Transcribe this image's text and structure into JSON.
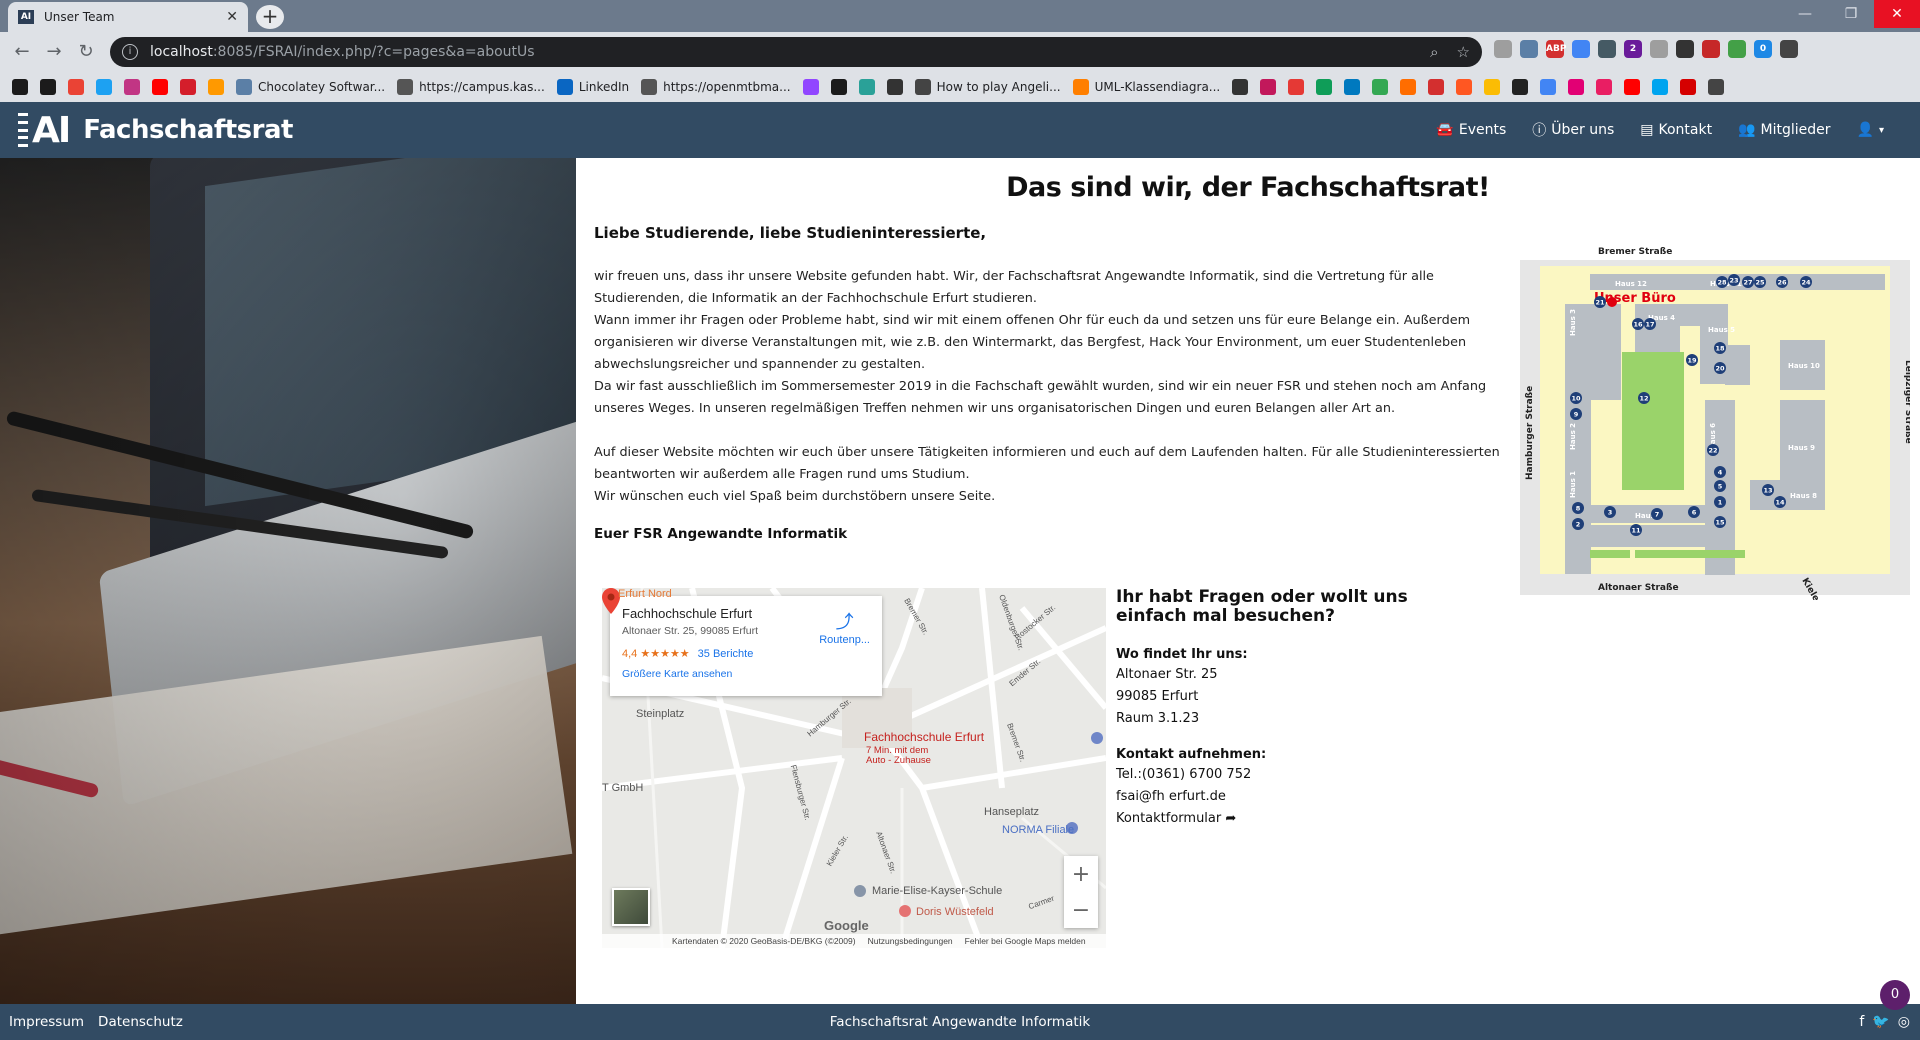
{
  "browser": {
    "tab_title": "Unser Team",
    "favicon_text": "AI",
    "url_host": "localhost",
    "url_path": ":8085/FSRAI/index.php/?c=pages&a=aboutUs",
    "bookmarks": [
      {
        "label": "",
        "color": "#1b1b1b"
      },
      {
        "label": "",
        "color": "#1b1b1b"
      },
      {
        "label": "",
        "color": "#ea4335"
      },
      {
        "label": "",
        "color": "#1da1f2"
      },
      {
        "label": "",
        "color": "#c13584"
      },
      {
        "label": "",
        "color": "#ff0000"
      },
      {
        "label": "",
        "color": "#d41e2b"
      },
      {
        "label": "",
        "color": "#ff9900"
      },
      {
        "label": "Chocolatey Softwar...",
        "color": "#5b7fa6"
      },
      {
        "label": "https://campus.kas...",
        "color": "#555555"
      },
      {
        "label": "LinkedIn",
        "color": "#0a66c2"
      },
      {
        "label": "https://openmtbma...",
        "color": "#555555"
      },
      {
        "label": "",
        "color": "#9146ff"
      },
      {
        "label": "",
        "color": "#1b1b1b"
      },
      {
        "label": "",
        "color": "#2aa198"
      },
      {
        "label": "",
        "color": "#333333"
      },
      {
        "label": "How to play Angeli...",
        "color": "#444444"
      },
      {
        "label": "UML-Klassendiagra...",
        "color": "#ff7f00"
      },
      {
        "label": "",
        "color": "#333333"
      },
      {
        "label": "",
        "color": "#c2185b"
      },
      {
        "label": "",
        "color": "#e53935"
      },
      {
        "label": "",
        "color": "#0f9d58"
      },
      {
        "label": "",
        "color": "#0079bf"
      },
      {
        "label": "",
        "color": "#34a853"
      },
      {
        "label": "",
        "color": "#ff6d00"
      },
      {
        "label": "",
        "color": "#d32f2f"
      },
      {
        "label": "",
        "color": "#ff5722"
      },
      {
        "label": "",
        "color": "#fbbc04"
      },
      {
        "label": "",
        "color": "#222222"
      },
      {
        "label": "",
        "color": "#4285f4"
      },
      {
        "label": "",
        "color": "#e20074"
      },
      {
        "label": "",
        "color": "#e91e63"
      },
      {
        "label": "",
        "color": "#ff0000"
      },
      {
        "label": "",
        "color": "#00a4ef"
      },
      {
        "label": "",
        "color": "#d50000"
      },
      {
        "label": "",
        "color": "#444444"
      }
    ],
    "extensions": [
      {
        "label": "",
        "color": "#9e9e9e"
      },
      {
        "label": "",
        "color": "#5b7fa6"
      },
      {
        "label": "ABP",
        "color": "#d32f2f"
      },
      {
        "label": "",
        "color": "#4285f4"
      },
      {
        "label": "",
        "color": "#455a64"
      },
      {
        "label": "2",
        "color": "#6a1b9a"
      },
      {
        "label": "",
        "color": "#9e9e9e"
      },
      {
        "label": "",
        "color": "#333333"
      },
      {
        "label": "",
        "color": "#c62828"
      },
      {
        "label": "",
        "color": "#43a047"
      },
      {
        "label": "0",
        "color": "#1e88e5"
      },
      {
        "label": "",
        "color": "#444444"
      }
    ]
  },
  "nav": {
    "brand": "Fachschaftsrat",
    "logo": "AI",
    "links": [
      {
        "label": "Events",
        "icon": "car-icon"
      },
      {
        "label": "Über uns",
        "icon": "info-icon"
      },
      {
        "label": "Kontakt",
        "icon": "address-card-icon"
      },
      {
        "label": "Mitglieder",
        "icon": "users-icon"
      }
    ],
    "user_icon": "user-icon"
  },
  "main": {
    "title": "Das sind wir, der Fachschaftsrat!",
    "greeting": "Liebe Studierende, liebe Studieninteressierte,",
    "paragraphs": [
      "wir freuen uns, dass ihr unsere Website gefunden habt. Wir, der Fachschaftsrat Angewandte Informatik, sind die Vertretung für alle Studierenden, die Informatik an der Fachhochschule Erfurt studieren.",
      "Wann immer ihr Fragen oder Probleme habt, sind wir mit einem offenen Ohr für euch da und setzen uns für eure Belange ein. Außerdem organisieren wir diverse Veranstaltungen mit, wie z.B. den Wintermarkt, das Bergfest, Hack Your Environment, um euer Studentenleben abwechslungsreicher und spannender zu gestalten.",
      "Da wir fast ausschließlich im Sommersemester 2019 in die Fachschaft gewählt wurden, sind wir ein neuer FSR und stehen noch am Anfang unseres Weges. In unseren regelmäßigen Treffen nehmen wir uns organisatorischen Dingen und euren Belangen aller Art an.",
      "Auf dieser Website möchten wir euch über unsere Tätigkeiten informieren und euch auf dem Laufenden halten. Für alle Studieninteressierten beantworten wir außerdem alle Fragen rund ums Studium.",
      "Wir wünschen euch viel Spaß beim durchstöbern unsere Seite."
    ],
    "signature": "Euer FSR Angewandte Informatik"
  },
  "campus_map": {
    "street_top": "Bremer Straße",
    "street_bottom": "Altonaer Straße",
    "street_left": "Hamburger Straße",
    "street_right": "Leipziger Straße",
    "street_corner": "Kieler",
    "office_label": "Unser Büro",
    "buildings": [
      "Haus 12",
      "Haus 11",
      "Haus 4",
      "Haus 5",
      "Haus 3",
      "Haus 10",
      "Haus 6",
      "Haus 2",
      "Haus 9",
      "Haus 1",
      "Haus 8",
      "Haus 7"
    ],
    "numbers": [
      "28",
      "23",
      "27",
      "25",
      "26",
      "24",
      "21",
      "16",
      "17",
      "18",
      "19",
      "20",
      "10",
      "12",
      "9",
      "22",
      "4",
      "5",
      "13",
      "14",
      "1",
      "8",
      "3",
      "7",
      "6",
      "2",
      "11",
      "15"
    ],
    "colors": {
      "ground": "#fbf7c2",
      "building": "#b8bec4",
      "lawn": "#9ad36a",
      "marker": "#1f3f78",
      "office": "#e0000f"
    }
  },
  "gmap": {
    "place_name": "Fachhochschule Erfurt",
    "address": "Altonaer Str. 25, 99085 Erfurt",
    "rating": "4,4",
    "stars": "★★★★★",
    "reviews": "35 Berichte",
    "bigger_map": "Größere Karte ansehen",
    "route": "Routenp...",
    "pin_label": "Fachhochschule Erfurt",
    "pin_sub1": "7 Min. mit dem",
    "pin_sub2": "Auto - Zuhause",
    "labels": {
      "erfurt_nord": "Erfurt Nord",
      "steinplatz": "Steinplatz",
      "gmbh": "T GmbH",
      "hanseplatz": "Hanseplatz",
      "norma": "NORMA Filiale",
      "marie": "Marie-Elise-Kayser-Schule",
      "doris": "Doris Wüstefeld",
      "hamburger": "Hamburger Str.",
      "bremer": "Bremer Str.",
      "bremer2": "Bremer Str.",
      "oldenburger": "Oldenburger Str.",
      "rostocker": "Rostocker Str.",
      "emder": "Emder Str.",
      "flensburger": "Flensburger Str.",
      "kieler": "Kieler Str.",
      "altonaer": "Altonaer Str.",
      "carmen": "Carmer"
    },
    "attribution": "Kartendaten © 2020 GeoBasis-DE/BKG (©2009)",
    "terms": "Nutzungsbedingungen",
    "report": "Fehler bei Google Maps melden",
    "google": "Google",
    "zoom_in": "+",
    "zoom_out": "−"
  },
  "contact": {
    "heading": "Ihr habt Fragen oder wollt uns einfach mal besuchen?",
    "where_label": "Wo findet Ihr uns:",
    "address_lines": [
      "Altonaer Str. 25",
      "99085 Erfurt",
      "Raum 3.1.23"
    ],
    "contact_label": "Kontakt aufnehmen:",
    "phone": "Tel.:(0361) 6700 752",
    "email": "fsai@fh erfurt.de",
    "form_link": "Kontaktformular"
  },
  "footer": {
    "impressum": "Impressum",
    "datenschutz": "Datenschutz",
    "center": "Fachschaftsrat Angewandte Informatik",
    "social": [
      "facebook-icon",
      "twitter-icon",
      "instagram-icon"
    ]
  },
  "badge_count": "0"
}
